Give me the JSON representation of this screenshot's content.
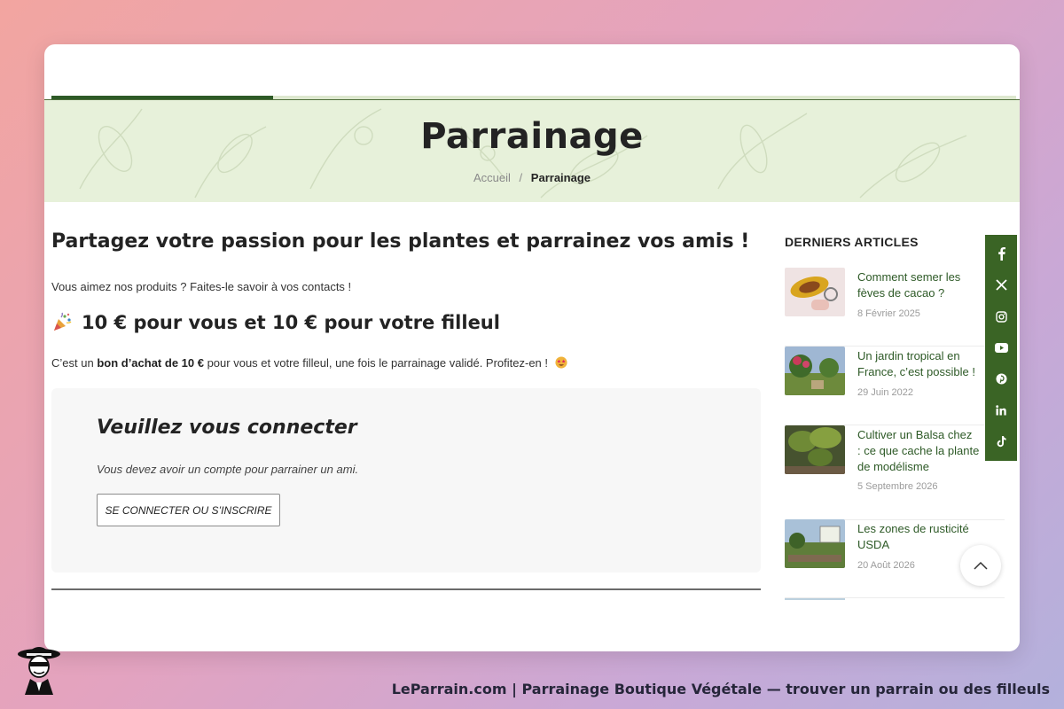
{
  "hero": {
    "title": "Parrainage",
    "breadcrumb": {
      "home": "Accueil",
      "separator": "/",
      "current": "Parrainage"
    }
  },
  "reading_progress_percent": 23,
  "main": {
    "headline": "Partagez votre passion pour les plantes et parrainez vos amis !",
    "intro": "Vous aimez nos produits ? Faites-le savoir à vos contacts !",
    "offer_title": "10 € pour vous et 10 € pour votre filleul",
    "offer_text_before": "C’est un ",
    "offer_text_bold": "bon d’achat de 10 €",
    "offer_text_after": " pour vous et votre filleul, une fois le parrainage validé. Profitez-en !",
    "login": {
      "title": "Veuillez vous connecter",
      "note": "Vous devez avoir un compte pour parrainer un ami.",
      "button_label": "SE CONNECTER OU S’INSCRIRE"
    }
  },
  "sidebar": {
    "title": "DERNIERS ARTICLES",
    "articles": [
      {
        "title": "Comment semer les\nfèves de cacao ?",
        "date": "8 Février 2025"
      },
      {
        "title": "Un jardin tropical en\nFrance, c’est possible !",
        "date": "29 Juin 2022"
      },
      {
        "title": "Cultiver un Balsa chez\n: ce que cache la plante\nde modélisme",
        "date": "5 Septembre 2026"
      },
      {
        "title": "Les zones de rusticité\nUSDA",
        "date": "20 Août 2026"
      }
    ]
  },
  "social": [
    "facebook-icon",
    "x-icon",
    "instagram-icon",
    "youtube-icon",
    "pinterest-icon",
    "linkedin-icon",
    "tiktok-icon"
  ],
  "colors": {
    "brand_green": "#3a6425",
    "hero_bg": "#e7f1da",
    "article_link": "#2e5a27"
  },
  "footer": {
    "caption": "LeParrain.com | Parrainage Boutique Végétale — trouver un parrain ou des filleuls"
  }
}
